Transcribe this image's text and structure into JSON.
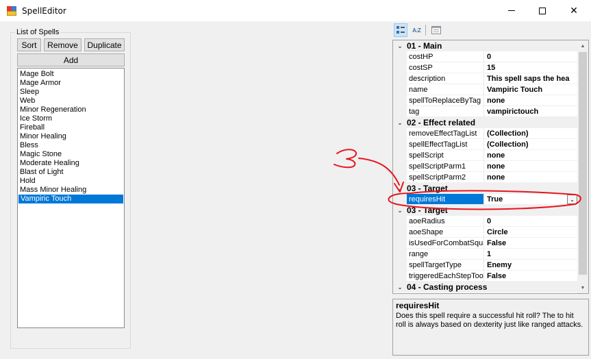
{
  "window": {
    "title": "SpellEditor",
    "minimize_icon": "minimize-icon",
    "maximize_icon": "maximize-icon",
    "close_glyph": "✕"
  },
  "spell_list": {
    "group_label": "List of Spells",
    "buttons": {
      "sort": "Sort",
      "remove": "Remove",
      "duplicate": "Duplicate",
      "add": "Add"
    },
    "items": [
      "Mage Bolt",
      "Mage Armor",
      "Sleep",
      "Web",
      "Minor Regeneration",
      "Ice Storm",
      "Fireball",
      "Minor Healing",
      "Bless",
      "Magic Stone",
      "Moderate Healing",
      "Blast of Light",
      "Hold",
      "Mass Minor Healing",
      "Vampiric Touch"
    ],
    "selected": "Vampiric Touch"
  },
  "toolbar": {
    "categorized_icon": "categorized-icon",
    "alphabetical_icon": "alphabetical-icon",
    "alphabetical_glyph": "A↓Z",
    "property_pages_icon": "property-pages-icon"
  },
  "property_grid": {
    "rows": [
      {
        "type": "cat",
        "label": "01 - Main",
        "caret": "⌄"
      },
      {
        "type": "prop",
        "name": "costHP",
        "value": "0"
      },
      {
        "type": "prop",
        "name": "costSP",
        "value": "15"
      },
      {
        "type": "prop",
        "name": "description",
        "value": "This spell saps the hea"
      },
      {
        "type": "prop",
        "name": "name",
        "value": "Vampiric Touch"
      },
      {
        "type": "prop",
        "name": "spellToReplaceByTag",
        "value": "none"
      },
      {
        "type": "prop",
        "name": "tag",
        "value": "vampirictouch"
      },
      {
        "type": "cat",
        "label": "02 - Effect related",
        "caret": "⌄"
      },
      {
        "type": "prop",
        "name": "removeEffectTagList",
        "value": "(Collection)"
      },
      {
        "type": "prop",
        "name": "spellEffectTagList",
        "value": "(Collection)"
      },
      {
        "type": "prop",
        "name": "spellScript",
        "value": "none"
      },
      {
        "type": "prop",
        "name": "spellScriptParm1",
        "value": "none"
      },
      {
        "type": "prop",
        "name": "spellScriptParm2",
        "value": "none"
      },
      {
        "type": "cat",
        "label": "03 - Target",
        "caret": "⌄"
      },
      {
        "type": "prop",
        "name": "requiresHit",
        "value": "True",
        "selected": true
      },
      {
        "type": "cat",
        "label": "03 - Target",
        "caret": "⌄"
      },
      {
        "type": "prop",
        "name": "aoeRadius",
        "value": "0"
      },
      {
        "type": "prop",
        "name": "aoeShape",
        "value": "Circle"
      },
      {
        "type": "prop",
        "name": "isUsedForCombatSqua",
        "value": "False"
      },
      {
        "type": "prop",
        "name": "range",
        "value": "1"
      },
      {
        "type": "prop",
        "name": "spellTargetType",
        "value": "Enemy"
      },
      {
        "type": "prop",
        "name": "triggeredEachStepToo",
        "value": "False"
      },
      {
        "type": "cat",
        "label": "04 - Casting process",
        "caret": "⌄"
      }
    ],
    "dropdown_glyph": "⌄",
    "scroll_up_glyph": "▲",
    "scroll_down_glyph": "▼"
  },
  "help": {
    "title": "requiresHit",
    "description": "Does this spell require a successful hit roll? The to hit roll is always based on dexterity just like ranged attacks."
  },
  "annotation": {
    "scribble_number": "3",
    "color": "#e8141c"
  }
}
